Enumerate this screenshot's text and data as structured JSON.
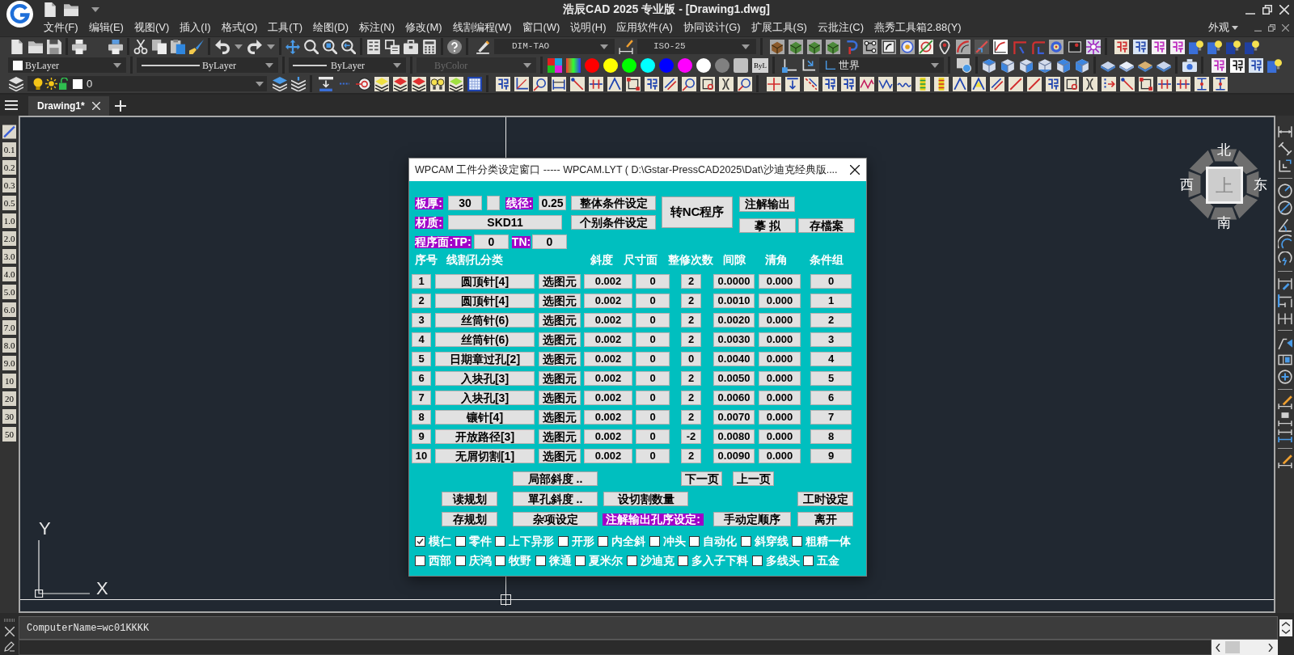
{
  "title_bar": {
    "title": "浩辰CAD 2025 专业版 - [Drawing1.dwg]"
  },
  "menu_bar": {
    "items": [
      "文件(F)",
      "编辑(E)",
      "视图(V)",
      "插入(I)",
      "格式(O)",
      "工具(T)",
      "绘图(D)",
      "标注(N)",
      "修改(M)",
      "线割编程(W)",
      "窗口(W)",
      "说明(H)",
      "应用软件(A)",
      "协同设计(G)",
      "扩展工具(S)",
      "云批注(C)",
      "燕秀工具箱2.88(Y)"
    ],
    "workspace": "外观"
  },
  "toolbars": {
    "text_style": "DIM-TAO",
    "dimension_style": "ISO-25",
    "color_setting": "ByLayer",
    "linetype": "ByLayer",
    "lineweight": "ByLayer",
    "plot_style": {
      "value": "ByColor",
      "disabled": true
    },
    "color_swatches": [
      {
        "color": "#ff0000",
        "kind": "circle"
      },
      {
        "color": "#ffff00",
        "kind": "circle"
      },
      {
        "color": "#00ff00",
        "kind": "circle"
      },
      {
        "color": "#00ffff",
        "kind": "circle"
      },
      {
        "color": "#0000ff",
        "kind": "circle"
      },
      {
        "color": "#ff00ff",
        "kind": "circle"
      },
      {
        "color": "#ffffff",
        "kind": "circle"
      },
      {
        "color": "#808080",
        "kind": "circle"
      },
      {
        "color": "#c0c0c0",
        "kind": "square"
      }
    ],
    "bylayer_button": "ByL",
    "ucs": "世界",
    "layer": "0"
  },
  "tabs": [
    {
      "label": "Drawing1*",
      "selected": true
    }
  ],
  "left_toolbar": [
    "0.1",
    "0.2",
    "0.3",
    "0.5",
    "1.0",
    "2.0",
    "3.0",
    "4.0",
    "5.0",
    "6.0",
    "7.0",
    "8.0",
    "9.0",
    "10",
    "20",
    "30",
    "50"
  ],
  "view_cube": {
    "north": "北",
    "west": "西",
    "top": "上",
    "east": "东",
    "south": "南"
  },
  "ucs_icon": {
    "y_label": "Y",
    "x_label": "X"
  },
  "dialog": {
    "title": "WPCAM 工件分类设定窗口 ----- WPCAM.LYT ( D:\\Gstar-PressCAD2025\\Dat\\沙迪克经典版....",
    "plate_thickness": {
      "label": "板厚:",
      "value": "30"
    },
    "wire_diameter": {
      "label": "线径:",
      "value": "0.25"
    },
    "material": {
      "label": "材质:",
      "value": "SKD11"
    },
    "program_face": {
      "label": "程序面:TP:",
      "value": "0"
    },
    "tn": {
      "label": "TN:",
      "value": "0"
    },
    "condition_buttons": [
      "整体条件设定",
      "个别条件设定"
    ],
    "nc_button": "转NC程序",
    "output_buttons": [
      "注解输出",
      "摹 拟",
      "存檔案"
    ],
    "table": {
      "columns": [
        "序号",
        "线割孔分类",
        "斜度",
        "尺寸面",
        "整修次数",
        "间隙",
        "清角",
        "条件组"
      ],
      "rows": [
        {
          "index": "1",
          "category": "圆顶针[4]",
          "pick": "选图元",
          "slope": "0.002",
          "size_face": "0",
          "trim_count": "2",
          "gap": "0.0000",
          "corner": "0.000",
          "group": "0"
        },
        {
          "index": "2",
          "category": "圆顶针[4]",
          "pick": "选图元",
          "slope": "0.002",
          "size_face": "0",
          "trim_count": "2",
          "gap": "0.0010",
          "corner": "0.000",
          "group": "1"
        },
        {
          "index": "3",
          "category": "丝筒针(6)",
          "pick": "选图元",
          "slope": "0.002",
          "size_face": "0",
          "trim_count": "2",
          "gap": "0.0020",
          "corner": "0.000",
          "group": "2"
        },
        {
          "index": "4",
          "category": "丝筒针(6)",
          "pick": "选图元",
          "slope": "0.002",
          "size_face": "0",
          "trim_count": "2",
          "gap": "0.0030",
          "corner": "0.000",
          "group": "3"
        },
        {
          "index": "5",
          "category": "日期章过孔[2]",
          "pick": "选图元",
          "slope": "0.002",
          "size_face": "0",
          "trim_count": "0",
          "gap": "0.0040",
          "corner": "0.000",
          "group": "4"
        },
        {
          "index": "6",
          "category": "入块孔[3]",
          "pick": "选图元",
          "slope": "0.002",
          "size_face": "0",
          "trim_count": "2",
          "gap": "0.0050",
          "corner": "0.000",
          "group": "5"
        },
        {
          "index": "7",
          "category": "入块孔[3]",
          "pick": "选图元",
          "slope": "0.002",
          "size_face": "0",
          "trim_count": "2",
          "gap": "0.0060",
          "corner": "0.000",
          "group": "6"
        },
        {
          "index": "8",
          "category": "镶针[4]",
          "pick": "选图元",
          "slope": "0.002",
          "size_face": "0",
          "trim_count": "2",
          "gap": "0.0070",
          "corner": "0.000",
          "group": "7"
        },
        {
          "index": "9",
          "category": "开放路径[3]",
          "pick": "选图元",
          "slope": "0.002",
          "size_face": "0",
          "trim_count": "-2",
          "gap": "0.0080",
          "corner": "0.000",
          "group": "8"
        },
        {
          "index": "10",
          "category": "无屑切割[1]",
          "pick": "选图元",
          "slope": "0.002",
          "size_face": "0",
          "trim_count": "2",
          "gap": "0.0090",
          "corner": "0.000",
          "group": "9"
        }
      ]
    },
    "action_rows": [
      {
        "items": [
          {
            "kind": "button",
            "label": "局部斜度 .."
          },
          {
            "kind": "button",
            "label": "下一页"
          },
          {
            "kind": "button",
            "label": "上一页"
          }
        ]
      },
      {
        "items": [
          {
            "kind": "button",
            "label": "读规划"
          },
          {
            "kind": "button",
            "label": "單孔斜度 .."
          },
          {
            "kind": "button",
            "label": "设切割数量"
          },
          {
            "kind": "button",
            "label": "工时设定"
          }
        ]
      },
      {
        "items": [
          {
            "kind": "button",
            "label": "存规划"
          },
          {
            "kind": "button",
            "label": "杂项设定"
          },
          {
            "kind": "label",
            "label": "注解输出孔序设定:"
          },
          {
            "kind": "button",
            "label": "手动定顺序"
          },
          {
            "kind": "button",
            "label": "离开"
          }
        ]
      }
    ],
    "option_rows": [
      {
        "items": [
          {
            "label": "模仁",
            "checked": true
          },
          {
            "label": "零件",
            "checked": false
          },
          {
            "label": "上下异形",
            "checked": false
          },
          {
            "label": "开形",
            "checked": false
          },
          {
            "label": "内全斜",
            "checked": false
          },
          {
            "label": "冲头",
            "checked": false
          },
          {
            "label": "自动化",
            "checked": false
          },
          {
            "label": "斜穿线",
            "checked": false
          },
          {
            "label": "粗精一体",
            "checked": false
          }
        ]
      },
      {
        "items": [
          {
            "label": "西部",
            "checked": false
          },
          {
            "label": "庆鸿",
            "checked": false
          },
          {
            "label": "牧野",
            "checked": false
          },
          {
            "label": "徕通",
            "checked": false
          },
          {
            "label": "夏米尔",
            "checked": false
          },
          {
            "label": "沙迪克",
            "checked": false
          },
          {
            "label": "多入子下料",
            "checked": false
          },
          {
            "label": "多线头",
            "checked": false
          },
          {
            "label": "五金",
            "checked": false
          }
        ]
      }
    ]
  },
  "command_line": {
    "history": [
      "ComputerName=wc01KKKK"
    ]
  }
}
